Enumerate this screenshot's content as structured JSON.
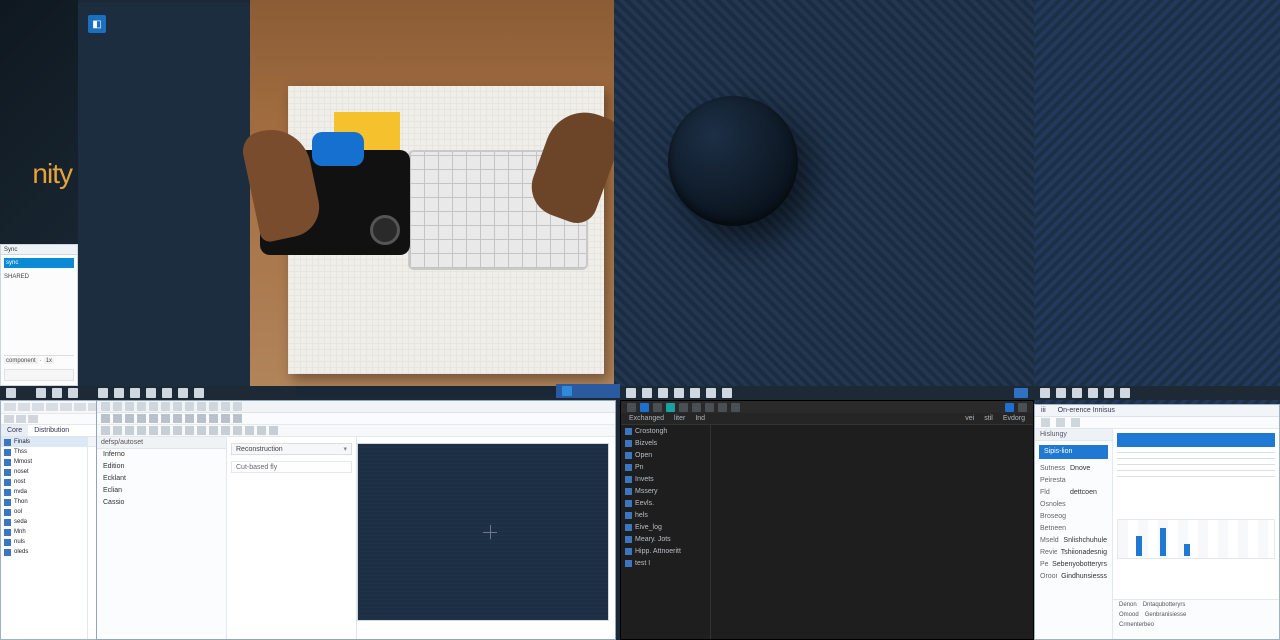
{
  "wallpaper": {
    "brand_fragment": "nity",
    "brand_color": "#e7a23a",
    "badge_glyph": "◧"
  },
  "mini_window": {
    "title": "Sync",
    "selected_file": "sync",
    "section": "SHARED",
    "tool_a": "component",
    "tool_b": "1x"
  },
  "explorer": {
    "tabs": [
      "Core",
      "Distribution"
    ],
    "tree": [
      {
        "label": "Finals"
      },
      {
        "label": "Thss"
      },
      {
        "label": "Mmost"
      },
      {
        "label": "noset"
      },
      {
        "label": "nost"
      },
      {
        "label": "nvda"
      },
      {
        "label": "Thon"
      },
      {
        "label": "ool"
      },
      {
        "label": "seda"
      },
      {
        "label": "Mnh"
      },
      {
        "label": "nuls"
      },
      {
        "label": "oleds"
      }
    ]
  },
  "ide": {
    "panel_header": "defsp/autoset",
    "options": [
      "Inferno",
      "Edition",
      "Ecklant",
      "Eclian",
      "Cassio"
    ],
    "dropdown": "Reconstruction",
    "filter": "Cut-based fly"
  },
  "dark_ide": {
    "menu": [
      "Exchanged",
      "liter",
      "Ind"
    ],
    "toolbar_right": [
      "vei",
      "stil",
      "Evdorg"
    ],
    "tree": [
      {
        "label": "Crostongh"
      },
      {
        "label": "Bizvels"
      },
      {
        "label": "Open"
      },
      {
        "label": "Pn"
      },
      {
        "label": "Invets"
      },
      {
        "label": "Mssery"
      },
      {
        "label": "Eevls."
      },
      {
        "label": "hels"
      },
      {
        "label": "Eive_log"
      },
      {
        "label": "Meary. Jots"
      },
      {
        "label": "Hipp. Attnoeritt"
      },
      {
        "label": "test I"
      }
    ]
  },
  "props": {
    "title_a": "iii",
    "title_b": "On-erence Innisus",
    "side_header": "Hislungy",
    "target": "Sipis-lion",
    "rows": [
      {
        "k": "Sutness",
        "v": "Dnove"
      },
      {
        "k": "Peirestalle",
        "v": ""
      },
      {
        "k": "Fld",
        "v": "dettcoen"
      },
      {
        "k": "Osnolesidsb",
        "v": ""
      },
      {
        "k": "Broseogint",
        "v": ""
      },
      {
        "k": "Betneenshsold",
        "v": ""
      },
      {
        "k": "Mseld",
        "v": "Snlishchuhule"
      },
      {
        "k": "Revied",
        "v": "Tshiionadesnig"
      },
      {
        "k": "Penon",
        "v": "Sebenyobotteryrs"
      },
      {
        "k": "Oroorl",
        "v": "Gindhunsiesss"
      }
    ],
    "footer": [
      {
        "a": "Denon",
        "b": "Dntaqubotteryrs"
      },
      {
        "a": "Omood",
        "b": "Genbranisiesse"
      },
      {
        "a": "Crmenterbeo",
        "b": ""
      }
    ]
  }
}
